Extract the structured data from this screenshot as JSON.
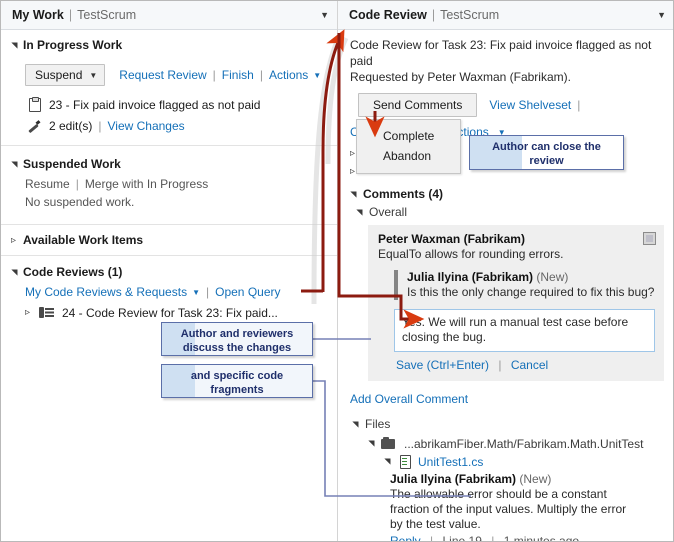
{
  "left_panel": {
    "header": {
      "title": "My Work",
      "separator": "|",
      "subtitle": "TestScrum",
      "caret": "▼"
    },
    "in_progress": {
      "title": "In Progress Work",
      "suspend_button": "Suspend",
      "request_review": "Request Review",
      "finish": "Finish",
      "actions": "Actions",
      "work_item": "23 - Fix paid invoice flagged as not paid",
      "edits": "2 edit(s)",
      "view_changes": "View Changes"
    },
    "suspended": {
      "title": "Suspended Work",
      "resume": "Resume",
      "merge": "Merge with In Progress",
      "empty": "No suspended work."
    },
    "available": {
      "title": "Available Work Items"
    },
    "code_reviews": {
      "title": "Code Reviews (1)",
      "my_reviews": "My Code Reviews & Requests",
      "open_query": "Open Query",
      "item": "24 - Code Review for Task 23: Fix paid..."
    }
  },
  "right_panel": {
    "header": {
      "title": "Code Review",
      "separator": "|",
      "subtitle": "TestScrum",
      "caret": "▼"
    },
    "description_line1": "Code Review for Task 23: Fix paid invoice flagged as not paid",
    "description_line2": "Requested by Peter Waxman (Fabrikam).",
    "send_comments": "Send Comments",
    "view_shelveset": "View Shelveset",
    "close_review": "Close Review",
    "actions": "Actions",
    "close_menu": {
      "complete": "Complete",
      "abandon": "Abandon"
    },
    "comments_header": "Comments (4)",
    "overall_header": "Overall",
    "comment": {
      "author": "Peter Waxman (Fabrikam)",
      "text": "EqualTo allows for rounding errors.",
      "reply_author": "Julia Ilyina (Fabrikam)",
      "reply_status": "(New)",
      "reply_text": "Is this the only change required to fix this bug?",
      "edit_value": "Yes. We will run a manual test case before closing the bug.",
      "save": "Save (Ctrl+Enter)",
      "cancel": "Cancel"
    },
    "add_overall_comment": "Add Overall Comment",
    "files": {
      "header": "Files",
      "folder": "...abrikamFiber.Math/Fabrikam.Math.UnitTest",
      "file": "UnitTest1.cs",
      "comment_author": "Julia Ilyina (Fabrikam)",
      "comment_status": "(New)",
      "comment_text": "The allowable error should be a constant fraction of the input values. Multiply the error by the test value.",
      "reply": "Reply",
      "line": "Line 19",
      "time": "1 minutes ago"
    }
  },
  "callouts": {
    "close_review": "Author can close the review",
    "discuss": "Author and reviewers discuss the changes",
    "fragments": "and specific code fragments"
  },
  "colors": {
    "link": "#1570b8",
    "arrow": "#8c1b10",
    "callout_border": "#5b6fa8",
    "callout_fill": "#cfe0f2",
    "connector": "#7680b5"
  }
}
